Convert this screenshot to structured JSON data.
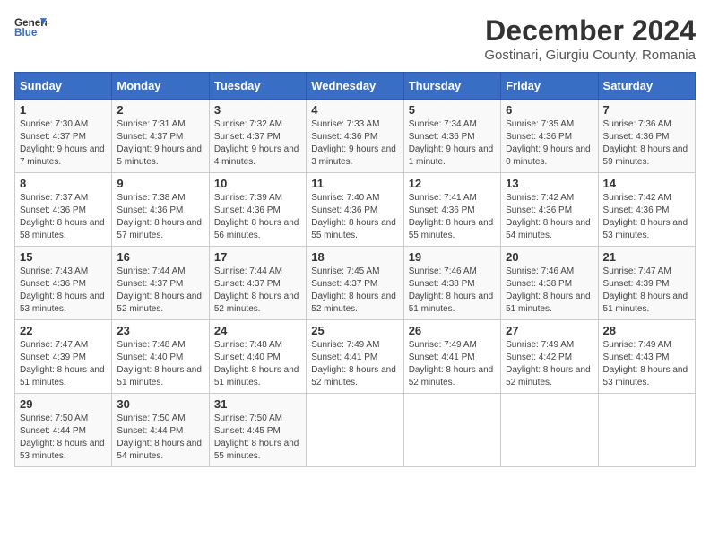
{
  "logo": {
    "line1": "General",
    "line2": "Blue"
  },
  "title": "December 2024",
  "subtitle": "Gostinari, Giurgiu County, Romania",
  "weekdays": [
    "Sunday",
    "Monday",
    "Tuesday",
    "Wednesday",
    "Thursday",
    "Friday",
    "Saturday"
  ],
  "weeks": [
    [
      {
        "day": "1",
        "info": "Sunrise: 7:30 AM\nSunset: 4:37 PM\nDaylight: 9 hours and 7 minutes."
      },
      {
        "day": "2",
        "info": "Sunrise: 7:31 AM\nSunset: 4:37 PM\nDaylight: 9 hours and 5 minutes."
      },
      {
        "day": "3",
        "info": "Sunrise: 7:32 AM\nSunset: 4:37 PM\nDaylight: 9 hours and 4 minutes."
      },
      {
        "day": "4",
        "info": "Sunrise: 7:33 AM\nSunset: 4:36 PM\nDaylight: 9 hours and 3 minutes."
      },
      {
        "day": "5",
        "info": "Sunrise: 7:34 AM\nSunset: 4:36 PM\nDaylight: 9 hours and 1 minute."
      },
      {
        "day": "6",
        "info": "Sunrise: 7:35 AM\nSunset: 4:36 PM\nDaylight: 9 hours and 0 minutes."
      },
      {
        "day": "7",
        "info": "Sunrise: 7:36 AM\nSunset: 4:36 PM\nDaylight: 8 hours and 59 minutes."
      }
    ],
    [
      {
        "day": "8",
        "info": "Sunrise: 7:37 AM\nSunset: 4:36 PM\nDaylight: 8 hours and 58 minutes."
      },
      {
        "day": "9",
        "info": "Sunrise: 7:38 AM\nSunset: 4:36 PM\nDaylight: 8 hours and 57 minutes."
      },
      {
        "day": "10",
        "info": "Sunrise: 7:39 AM\nSunset: 4:36 PM\nDaylight: 8 hours and 56 minutes."
      },
      {
        "day": "11",
        "info": "Sunrise: 7:40 AM\nSunset: 4:36 PM\nDaylight: 8 hours and 55 minutes."
      },
      {
        "day": "12",
        "info": "Sunrise: 7:41 AM\nSunset: 4:36 PM\nDaylight: 8 hours and 55 minutes."
      },
      {
        "day": "13",
        "info": "Sunrise: 7:42 AM\nSunset: 4:36 PM\nDaylight: 8 hours and 54 minutes."
      },
      {
        "day": "14",
        "info": "Sunrise: 7:42 AM\nSunset: 4:36 PM\nDaylight: 8 hours and 53 minutes."
      }
    ],
    [
      {
        "day": "15",
        "info": "Sunrise: 7:43 AM\nSunset: 4:36 PM\nDaylight: 8 hours and 53 minutes."
      },
      {
        "day": "16",
        "info": "Sunrise: 7:44 AM\nSunset: 4:37 PM\nDaylight: 8 hours and 52 minutes."
      },
      {
        "day": "17",
        "info": "Sunrise: 7:44 AM\nSunset: 4:37 PM\nDaylight: 8 hours and 52 minutes."
      },
      {
        "day": "18",
        "info": "Sunrise: 7:45 AM\nSunset: 4:37 PM\nDaylight: 8 hours and 52 minutes."
      },
      {
        "day": "19",
        "info": "Sunrise: 7:46 AM\nSunset: 4:38 PM\nDaylight: 8 hours and 51 minutes."
      },
      {
        "day": "20",
        "info": "Sunrise: 7:46 AM\nSunset: 4:38 PM\nDaylight: 8 hours and 51 minutes."
      },
      {
        "day": "21",
        "info": "Sunrise: 7:47 AM\nSunset: 4:39 PM\nDaylight: 8 hours and 51 minutes."
      }
    ],
    [
      {
        "day": "22",
        "info": "Sunrise: 7:47 AM\nSunset: 4:39 PM\nDaylight: 8 hours and 51 minutes."
      },
      {
        "day": "23",
        "info": "Sunrise: 7:48 AM\nSunset: 4:40 PM\nDaylight: 8 hours and 51 minutes."
      },
      {
        "day": "24",
        "info": "Sunrise: 7:48 AM\nSunset: 4:40 PM\nDaylight: 8 hours and 51 minutes."
      },
      {
        "day": "25",
        "info": "Sunrise: 7:49 AM\nSunset: 4:41 PM\nDaylight: 8 hours and 52 minutes."
      },
      {
        "day": "26",
        "info": "Sunrise: 7:49 AM\nSunset: 4:41 PM\nDaylight: 8 hours and 52 minutes."
      },
      {
        "day": "27",
        "info": "Sunrise: 7:49 AM\nSunset: 4:42 PM\nDaylight: 8 hours and 52 minutes."
      },
      {
        "day": "28",
        "info": "Sunrise: 7:49 AM\nSunset: 4:43 PM\nDaylight: 8 hours and 53 minutes."
      }
    ],
    [
      {
        "day": "29",
        "info": "Sunrise: 7:50 AM\nSunset: 4:44 PM\nDaylight: 8 hours and 53 minutes."
      },
      {
        "day": "30",
        "info": "Sunrise: 7:50 AM\nSunset: 4:44 PM\nDaylight: 8 hours and 54 minutes."
      },
      {
        "day": "31",
        "info": "Sunrise: 7:50 AM\nSunset: 4:45 PM\nDaylight: 8 hours and 55 minutes."
      },
      null,
      null,
      null,
      null
    ]
  ]
}
